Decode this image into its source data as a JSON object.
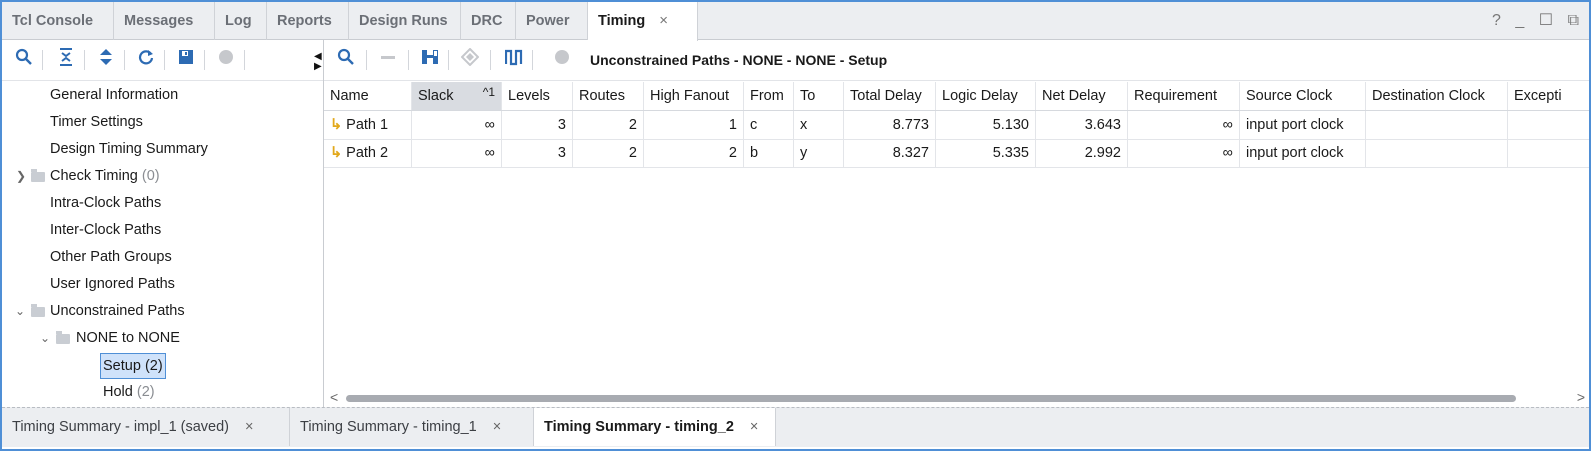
{
  "top_tabs": [
    {
      "label": "Tcl Console"
    },
    {
      "label": "Messages"
    },
    {
      "label": "Log"
    },
    {
      "label": "Reports"
    },
    {
      "label": "Design Runs"
    },
    {
      "label": "DRC"
    },
    {
      "label": "Power"
    },
    {
      "label": "Timing",
      "active": true
    }
  ],
  "window_controls": {
    "help": "?",
    "minimize": "_",
    "maximize": "☐",
    "restore": "⧉"
  },
  "tab_close": "×",
  "tree": [
    {
      "label": "General Information"
    },
    {
      "label": "Timer Settings"
    },
    {
      "label": "Design Timing Summary"
    },
    {
      "label": "Check Timing",
      "count": "(0)"
    },
    {
      "label": "Intra-Clock Paths"
    },
    {
      "label": "Inter-Clock Paths"
    },
    {
      "label": "Other Path Groups"
    },
    {
      "label": "User Ignored Paths"
    },
    {
      "label": "Unconstrained Paths"
    },
    {
      "label": "NONE to NONE"
    },
    {
      "label": "Setup",
      "count": "(2)"
    },
    {
      "label": "Hold",
      "count": "(2)"
    }
  ],
  "right_title": "Unconstrained Paths - NONE - NONE - Setup",
  "table": {
    "columns": [
      "Name",
      "Slack",
      "Levels",
      "Routes",
      "High Fanout",
      "From",
      "To",
      "Total Delay",
      "Logic Delay",
      "Net Delay",
      "Requirement",
      "Source Clock",
      "Destination Clock",
      "Excepti"
    ],
    "sort_indicator": "^1",
    "rows": [
      [
        "Path 1",
        "∞",
        "3",
        "2",
        "1",
        "c",
        "x",
        "8.773",
        "5.130",
        "3.643",
        "∞",
        "input port clock",
        "",
        ""
      ],
      [
        "Path 2",
        "∞",
        "3",
        "2",
        "2",
        "b",
        "y",
        "8.327",
        "5.335",
        "2.992",
        "∞",
        "input port clock",
        "",
        ""
      ]
    ]
  },
  "bottom_tabs": [
    {
      "label": "Timing Summary - impl_1 (saved)"
    },
    {
      "label": "Timing Summary - timing_1"
    },
    {
      "label": "Timing Summary - timing_2",
      "active": true
    }
  ],
  "colors": {
    "accent": "#4f8fd6",
    "icon_blue": "#2d6bb3",
    "path_icon": "#e2a81b"
  }
}
